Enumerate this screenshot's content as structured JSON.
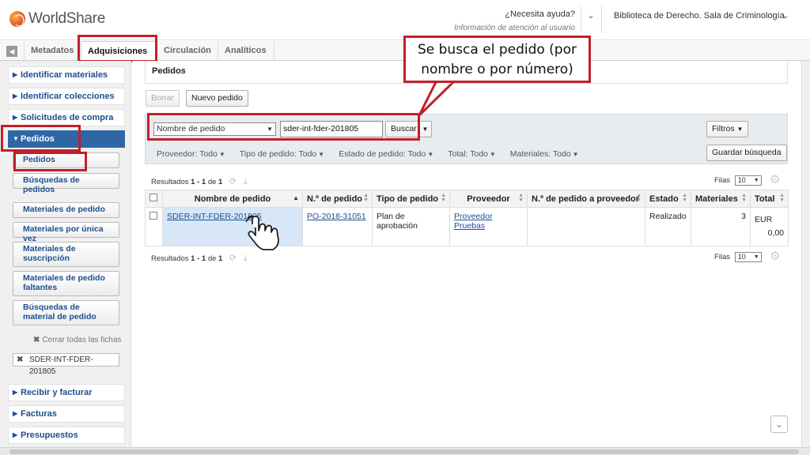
{
  "header": {
    "logo_text": "WorldShare",
    "help_title": "¿Necesita ayuda?",
    "help_sub": "Información de atención al usuario",
    "library": "Biblioteca de Derecho. Sala de Criminología"
  },
  "tabs": [
    "Metadatos",
    "Adquisiciones",
    "Circulación",
    "Analíticos"
  ],
  "sidebar": {
    "sections": [
      "Identificar materiales",
      "Identificar colecciones",
      "Solicitudes de compra",
      "Pedidos"
    ],
    "pedidos_buttons": [
      "Pedidos",
      "Búsquedas de pedidos"
    ],
    "material_buttons": [
      "Materiales de pedido",
      "Materiales por única vez",
      "Materiales de suscripción",
      "Materiales de pedido faltantes",
      "Búsquedas de material de pedido"
    ],
    "close_all": "Cerrar todas las fichas",
    "open_card": "SDER-INT-FDER-201805",
    "bottom_sections": [
      "Recibir y facturar",
      "Facturas",
      "Presupuestos"
    ]
  },
  "main": {
    "panel_title": "Pedidos",
    "btn_clear": "Borrar",
    "btn_new": "Nuevo pedido",
    "search_field": "Nombre de pedido",
    "search_value": "sder-int-fder-201805",
    "btn_search": "Buscar",
    "btn_filters": "Filtros",
    "btn_save_search": "Guardar búsqueda",
    "filters": [
      "Proveedor: Todo",
      "Tipo de pedido: Todo",
      "Estado de pedido: Todo",
      "Total: Todo",
      "Materiales: Todo"
    ],
    "results_prefix": "Resultados",
    "results_range": "1 - 1",
    "results_of": "de",
    "results_total": "1",
    "rows_label": "Filas",
    "rows_value": "10"
  },
  "table": {
    "columns": [
      "Nombre de pedido",
      "N.º de pedido",
      "Tipo de pedido",
      "Proveedor",
      "N.º de pedido a proveedor",
      "Estado",
      "Materiales",
      "Total"
    ],
    "row": {
      "nombre": "SDER-INT-FDER-201805",
      "numero": "PO-2018-31051",
      "tipo": "Plan de aprobación",
      "proveedor": "Proveedor Pruebas",
      "num_proveedor": "",
      "estado": "Realizado",
      "materiales": "3",
      "moneda": "EUR",
      "total": "0,00"
    }
  },
  "callout": {
    "line1": "Se busca el pedido (por",
    "line2": "nombre o por número)"
  },
  "colors": {
    "accent_blue": "#1d4f8f",
    "annotation_red": "#c1202a",
    "selected_row": "#d7e7f8"
  }
}
